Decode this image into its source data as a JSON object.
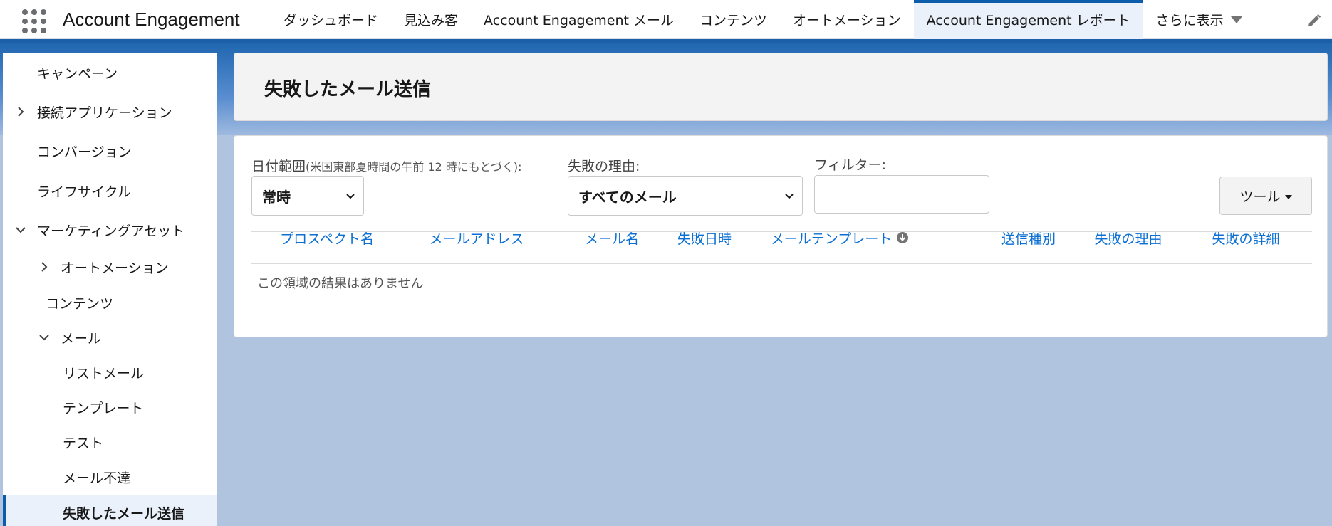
{
  "app": {
    "name": "Account Engagement"
  },
  "nav": {
    "items": [
      {
        "label": "ダッシュボード"
      },
      {
        "label": "見込み客"
      },
      {
        "label": "Account Engagement メール"
      },
      {
        "label": "コンテンツ"
      },
      {
        "label": "オートメーション"
      },
      {
        "label": "Account Engagement レポート",
        "active": true
      }
    ],
    "more_label": "さらに表示"
  },
  "sidebar": {
    "items": [
      {
        "label": "キャンペーン"
      },
      {
        "label": "接続アプリケーション",
        "chevron": "right"
      },
      {
        "label": "コンバージョン"
      },
      {
        "label": "ライフサイクル"
      },
      {
        "label": "マーケティングアセット",
        "chevron": "down"
      },
      {
        "label": "オートメーション",
        "chevron": "right"
      },
      {
        "label": "コンテンツ"
      },
      {
        "label": "メール",
        "chevron": "down"
      },
      {
        "label": "リストメール"
      },
      {
        "label": "テンプレート"
      },
      {
        "label": "テスト"
      },
      {
        "label": "メール不達"
      },
      {
        "label": "失敗したメール送信",
        "selected": true
      }
    ]
  },
  "page": {
    "title": "失敗したメール送信"
  },
  "filters": {
    "date_range_label": "日付範囲",
    "date_range_note": "(米国東部夏時間の午前 12 時にもとづく):",
    "date_range_value": "常時",
    "reason_label": "失敗の理由:",
    "reason_value": "すべてのメール",
    "filter_label": "フィルター:",
    "filter_value": "",
    "tools_label": "ツール"
  },
  "table": {
    "columns": [
      "プロスペクト名",
      "メールアドレス",
      "メール名",
      "失敗日時",
      "メールテンプレート",
      "送信種別",
      "失敗の理由",
      "失敗の詳細"
    ],
    "empty_message": "この領域の結果はありません"
  },
  "colors": {
    "brand_blue": "#0b5cab",
    "link_blue": "#0b6fd3",
    "background": "#b0c4df"
  },
  "icons": {
    "app_launcher": "waffle-icon",
    "edit": "pencil-icon",
    "sort": "arrow-down-circle-icon"
  }
}
